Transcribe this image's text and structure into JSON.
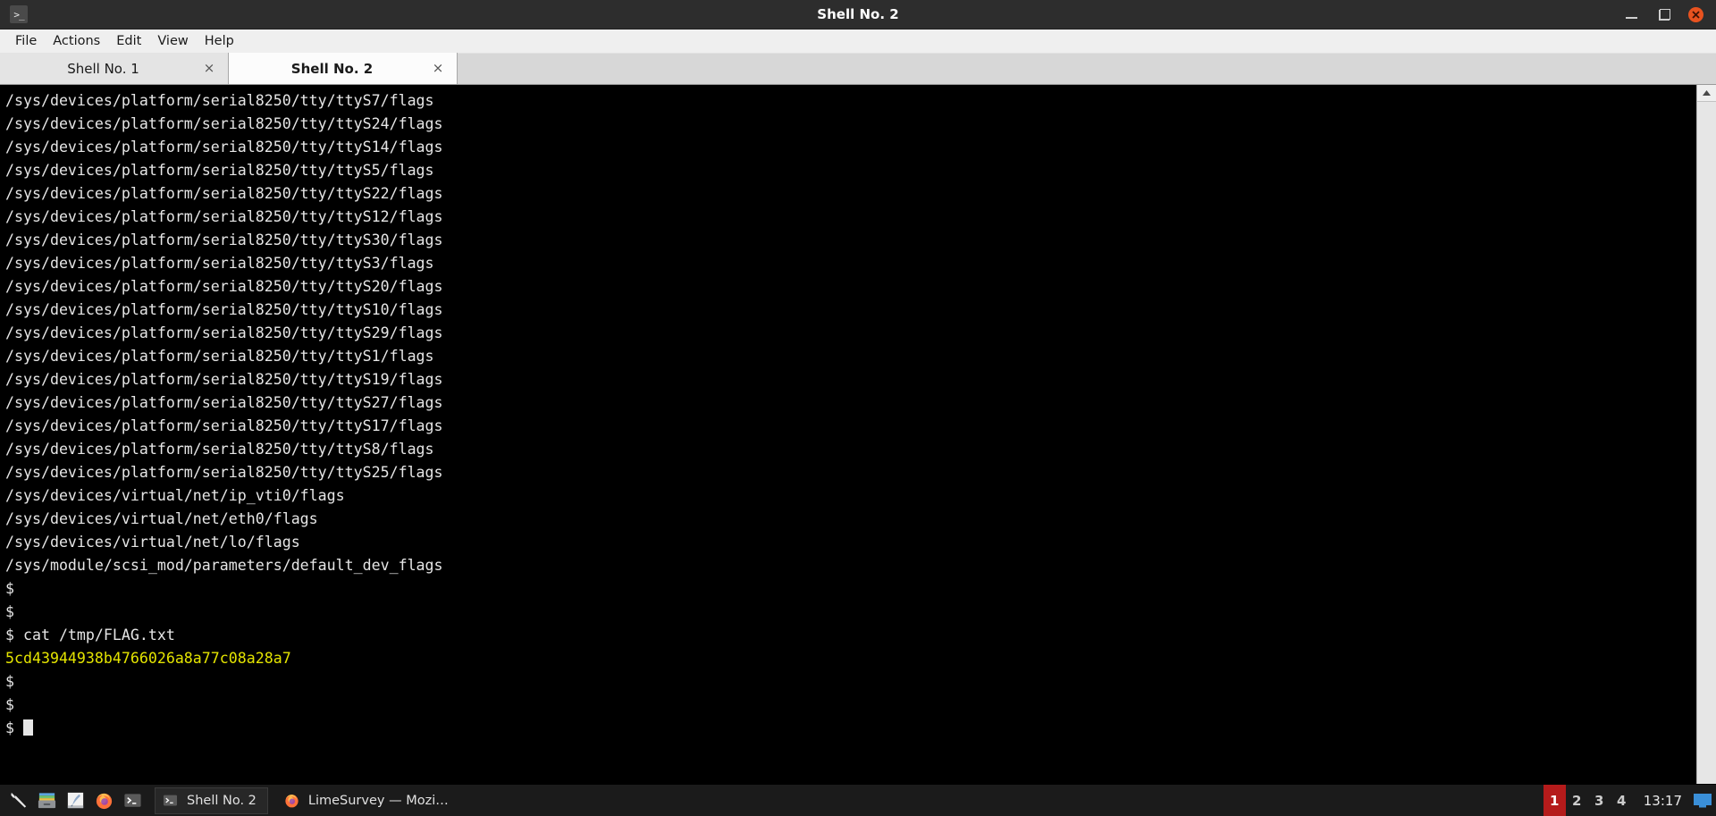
{
  "window": {
    "title": "Shell No. 2",
    "icon": "terminal-icon",
    "controls": {
      "minimize": "minimize-button",
      "maximize": "maximize-button",
      "close": "close-button"
    }
  },
  "menubar": {
    "items": [
      {
        "label": "File"
      },
      {
        "label": "Actions"
      },
      {
        "label": "Edit"
      },
      {
        "label": "View"
      },
      {
        "label": "Help"
      }
    ]
  },
  "tabs": [
    {
      "label": "Shell No. 1",
      "active": false,
      "close": "×"
    },
    {
      "label": "Shell No. 2",
      "active": true,
      "close": "×"
    }
  ],
  "terminal": {
    "prompt": "$",
    "command": "cat /tmp/FLAG.txt",
    "flag_value": "5cd43944938b4766026a8a77c08a28a7",
    "flag_color": "#e4e400",
    "background": "#000000",
    "foreground": "#e6e6e6",
    "lines": [
      {
        "text": "/sys/devices/platform/serial8250/tty/ttyS7/flags"
      },
      {
        "text": "/sys/devices/platform/serial8250/tty/ttyS24/flags"
      },
      {
        "text": "/sys/devices/platform/serial8250/tty/ttyS14/flags"
      },
      {
        "text": "/sys/devices/platform/serial8250/tty/ttyS5/flags"
      },
      {
        "text": "/sys/devices/platform/serial8250/tty/ttyS22/flags"
      },
      {
        "text": "/sys/devices/platform/serial8250/tty/ttyS12/flags"
      },
      {
        "text": "/sys/devices/platform/serial8250/tty/ttyS30/flags"
      },
      {
        "text": "/sys/devices/platform/serial8250/tty/ttyS3/flags"
      },
      {
        "text": "/sys/devices/platform/serial8250/tty/ttyS20/flags"
      },
      {
        "text": "/sys/devices/platform/serial8250/tty/ttyS10/flags"
      },
      {
        "text": "/sys/devices/platform/serial8250/tty/ttyS29/flags"
      },
      {
        "text": "/sys/devices/platform/serial8250/tty/ttyS1/flags"
      },
      {
        "text": "/sys/devices/platform/serial8250/tty/ttyS19/flags"
      },
      {
        "text": "/sys/devices/platform/serial8250/tty/ttyS27/flags"
      },
      {
        "text": "/sys/devices/platform/serial8250/tty/ttyS17/flags"
      },
      {
        "text": "/sys/devices/platform/serial8250/tty/ttyS8/flags"
      },
      {
        "text": "/sys/devices/platform/serial8250/tty/ttyS25/flags"
      },
      {
        "text": "/sys/devices/virtual/net/ip_vti0/flags"
      },
      {
        "text": "/sys/devices/virtual/net/eth0/flags"
      },
      {
        "text": "/sys/devices/virtual/net/lo/flags"
      },
      {
        "text": "/sys/module/scsi_mod/parameters/default_dev_flags"
      },
      {
        "text": "$"
      },
      {
        "text": "$"
      },
      {
        "text": "$ cat /tmp/FLAG.txt"
      },
      {
        "text": "5cd43944938b4766026a8a77c08a28a7",
        "flag": true
      },
      {
        "text": "$"
      },
      {
        "text": "$"
      },
      {
        "text": "$ ",
        "cursor": true
      }
    ]
  },
  "scrollbar": {
    "up_arrow": "scroll-up-arrow"
  },
  "taskbar": {
    "launchers": [
      {
        "name": "wrench-icon"
      },
      {
        "name": "file-manager-icon"
      },
      {
        "name": "text-editor-icon"
      },
      {
        "name": "firefox-icon"
      },
      {
        "name": "terminal-icon"
      }
    ],
    "windows": [
      {
        "label": "Shell No. 2",
        "icon": "terminal-icon",
        "active": true
      },
      {
        "label": "LimeSurvey — Mozi…",
        "icon": "firefox-icon",
        "active": false
      }
    ],
    "workspaces": [
      {
        "label": "1",
        "active": true
      },
      {
        "label": "2",
        "active": false
      },
      {
        "label": "3",
        "active": false
      },
      {
        "label": "4",
        "active": false
      }
    ],
    "clock": "13:17",
    "active_workspace_color": "#b51b1b",
    "tray": [
      {
        "name": "display-icon"
      }
    ]
  }
}
